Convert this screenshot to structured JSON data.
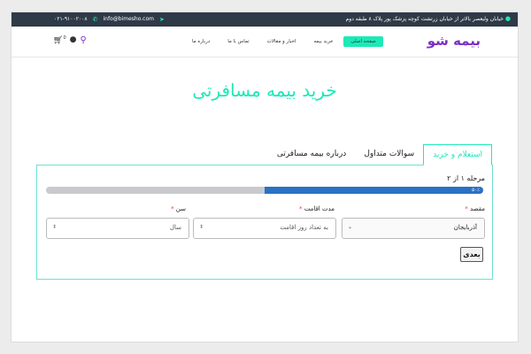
{
  "topbar": {
    "address": "خیابان ولیعصر بالاتر از خیابان زرتشت کوچه پزشک پور پلاک ۸ طبقه دوم",
    "email": "info@bimesho.com",
    "phone": "۰۲۱-۹۱۰۰۲۰۰۸"
  },
  "header": {
    "logo": "بیمه شو",
    "nav": [
      "صفحه اصلی",
      "خرید بیمه",
      "اخبار و مقالات",
      "تماس با ما",
      "درباره ما"
    ],
    "active_nav": "صفحه اصلی",
    "cart_count": "0"
  },
  "page": {
    "title": "خرید بیمه مسافرتی"
  },
  "tabs": [
    "استعلام و خرید",
    "سوالات متداول",
    "درباره بیمه مسافرتی"
  ],
  "form": {
    "step_text": "مرحله ۱ از ۲",
    "progress_percent": 50,
    "progress_label": "۵۰٪",
    "destination": {
      "label": "مقصد",
      "value": "آذربایجان"
    },
    "duration": {
      "label": "مدت اقامت",
      "placeholder": "به تعداد روز اقامت"
    },
    "age": {
      "label": "سن",
      "placeholder": "سال"
    },
    "next_button": "بعدی"
  },
  "colors": {
    "accent": "#1de9b6",
    "brand": "#7a2fc4",
    "progress": "#2a72c3",
    "topbar": "#2e3a47"
  }
}
